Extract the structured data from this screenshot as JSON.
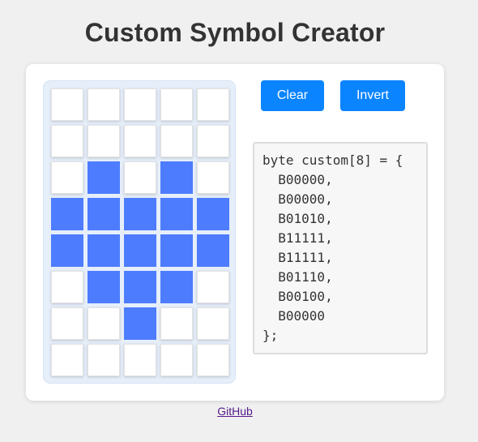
{
  "header": {
    "title": "Custom Symbol Creator"
  },
  "toolbar": {
    "clear_label": "Clear",
    "invert_label": "Invert"
  },
  "grid": {
    "rows": [
      [
        0,
        0,
        0,
        0,
        0
      ],
      [
        0,
        0,
        0,
        0,
        0
      ],
      [
        0,
        1,
        0,
        1,
        0
      ],
      [
        1,
        1,
        1,
        1,
        1
      ],
      [
        1,
        1,
        1,
        1,
        1
      ],
      [
        0,
        1,
        1,
        1,
        0
      ],
      [
        0,
        0,
        1,
        0,
        0
      ],
      [
        0,
        0,
        0,
        0,
        0
      ]
    ],
    "on_color": "#4d7cfe",
    "off_color": "#ffffff"
  },
  "code": {
    "lines": [
      "byte custom[8] = {",
      "  B00000,",
      "  B00000,",
      "  B01010,",
      "  B11111,",
      "  B11111,",
      "  B01110,",
      "  B00100,",
      "  B00000",
      "};"
    ]
  },
  "footer": {
    "link_label": "GitHub"
  },
  "colors": {
    "button": "#0a84ff",
    "page_background": "#f0f0f0"
  }
}
